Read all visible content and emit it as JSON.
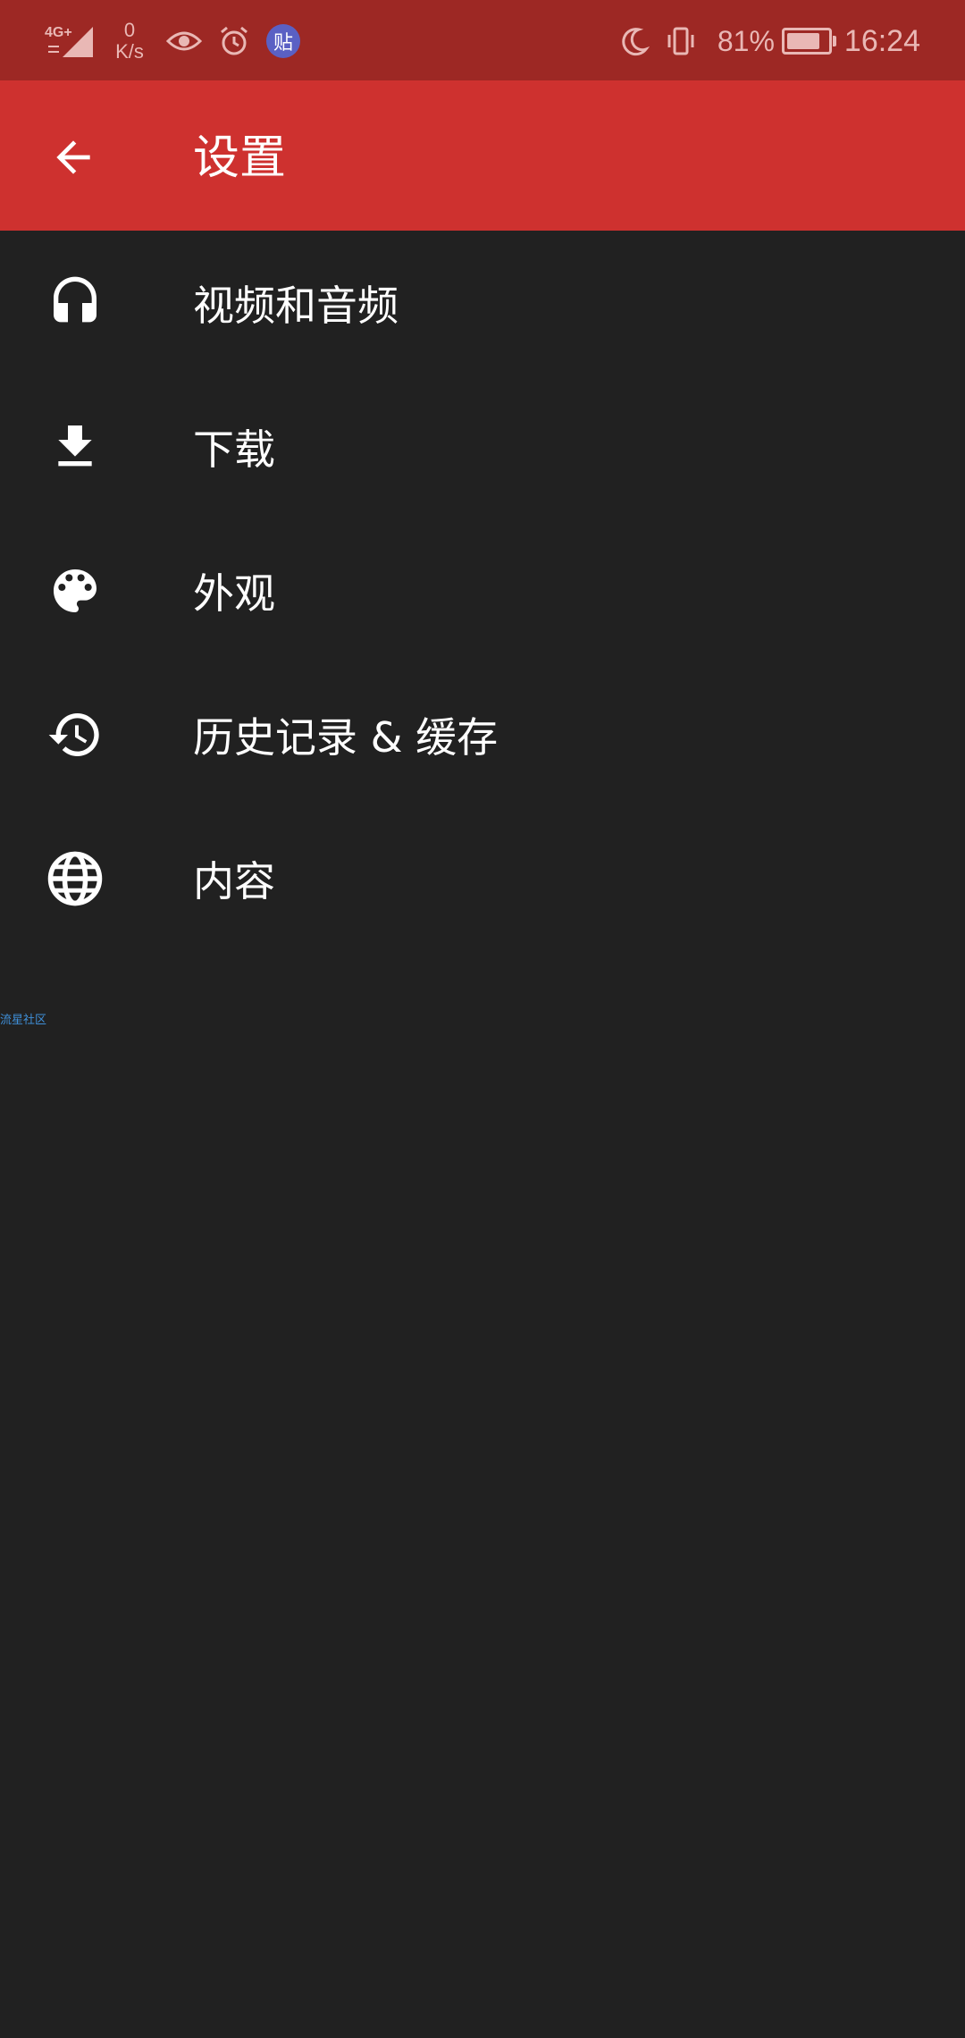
{
  "status_bar": {
    "network": "4G+",
    "speed_value": "0",
    "speed_unit": "K/s",
    "notif_badge": "贴",
    "battery_percent": "81%",
    "battery_level": 0.81,
    "time": "16:24",
    "icons": [
      "signal-icon",
      "eye-icon",
      "alarm-icon",
      "tieba-icon",
      "moon-icon",
      "vibrate-icon",
      "battery-icon"
    ]
  },
  "app_bar": {
    "title": "设置",
    "back_icon": "arrow-back-icon",
    "color": "#ce312f"
  },
  "settings": {
    "items": [
      {
        "label": "视频和音频",
        "icon": "headphones-icon"
      },
      {
        "label": "下载",
        "icon": "download-icon"
      },
      {
        "label": "外观",
        "icon": "palette-icon"
      },
      {
        "label": "历史记录 & 缓存",
        "icon": "history-icon"
      },
      {
        "label": "内容",
        "icon": "globe-icon"
      }
    ]
  },
  "watermark": "流星社区",
  "colors": {
    "status_bar": "#9d2824",
    "app_bar": "#ce312f",
    "background": "#212121",
    "text": "#ffffff"
  }
}
